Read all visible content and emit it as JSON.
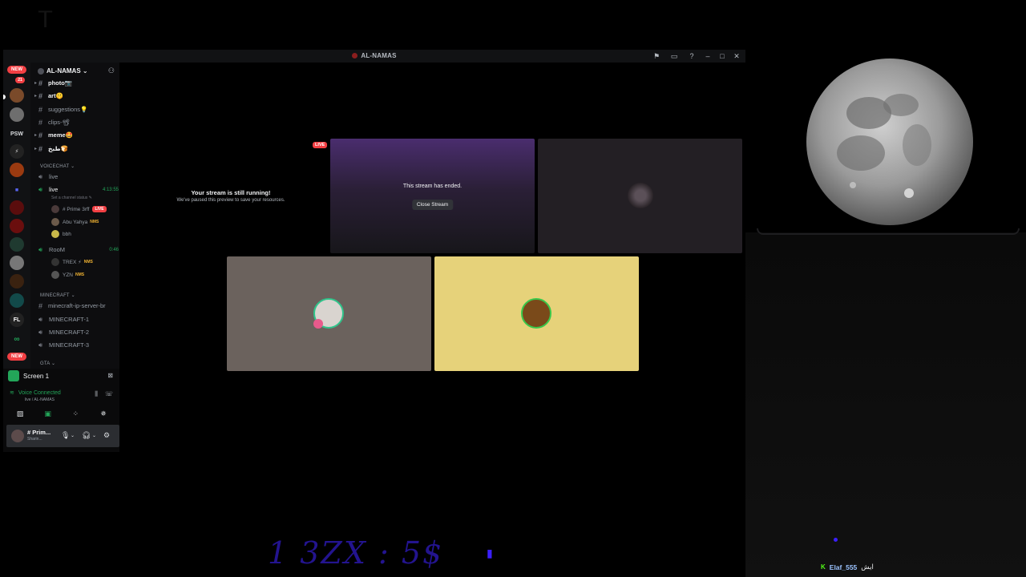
{
  "window": {
    "title": "AL-NAMAS"
  },
  "titlebar_icons": [
    "flag-icon",
    "inbox-icon",
    "help-icon",
    "minimize-icon",
    "maximize-icon",
    "close-icon"
  ],
  "rail": {
    "new_badge": "NEW",
    "psw_label": "PSW",
    "fl_label": "FL",
    "count_badge": "21"
  },
  "server": {
    "name": "AL-NAMAS"
  },
  "channels": [
    {
      "name": "photo📷",
      "unread": true
    },
    {
      "name": "art🤫",
      "unread": true
    },
    {
      "name": "suggestions💡",
      "unread": false
    },
    {
      "name": "clips-📽",
      "unread": false
    },
    {
      "name": "meme🤩",
      "unread": true
    },
    {
      "name": "طبخ🍞",
      "unread": true
    }
  ],
  "voicechat": {
    "category": "VOICECHAT",
    "channels": [
      {
        "name": "live"
      },
      {
        "name": "live",
        "timer": "4:13:55",
        "status": "Set a channel status",
        "members": [
          {
            "name": "# Prime 3rff",
            "live": "LIVE"
          },
          {
            "name": "Abu Yahya",
            "tag": "NMS"
          },
          {
            "name": "bbh"
          }
        ]
      },
      {
        "name": "RooM",
        "timer": "0:46",
        "members": [
          {
            "name": "TREX ⚡",
            "tag": "NMS"
          },
          {
            "name": "YZN",
            "tag": "NMS"
          }
        ]
      }
    ]
  },
  "minecraft": {
    "category": "MINECRAFT",
    "channels": [
      "minecraft-ip-server-br",
      "MINECRAFT-1",
      "MINECRAFT-2",
      "MINECRAFT-3"
    ]
  },
  "gta_category": "GTA",
  "bottom_panel": {
    "screen_label": "Screen 1",
    "voice_status": "Voice Connected",
    "voice_sub": "live / AL-NAMAS",
    "user_name": "# Prim...",
    "user_status": "Sharin..."
  },
  "stage": {
    "live_tag": "LIVE",
    "running_title": "Your stream is still running!",
    "running_sub": "We've paused this preview to save your resources.",
    "ended_text": "This stream has ended.",
    "close_stream": "Close Stream"
  },
  "overlay": {
    "promo_text": "1 3ZX : 5$",
    "chat_user": "Elaf_555",
    "chat_message": "ايش"
  },
  "colors": {
    "accent_green": "#23a559",
    "live_red": "#f23f43",
    "tile_gray": "#6b625d",
    "tile_yellow": "#e6d27a",
    "tile_dark": "#231f24",
    "promo_purple": "#2a18a8"
  }
}
